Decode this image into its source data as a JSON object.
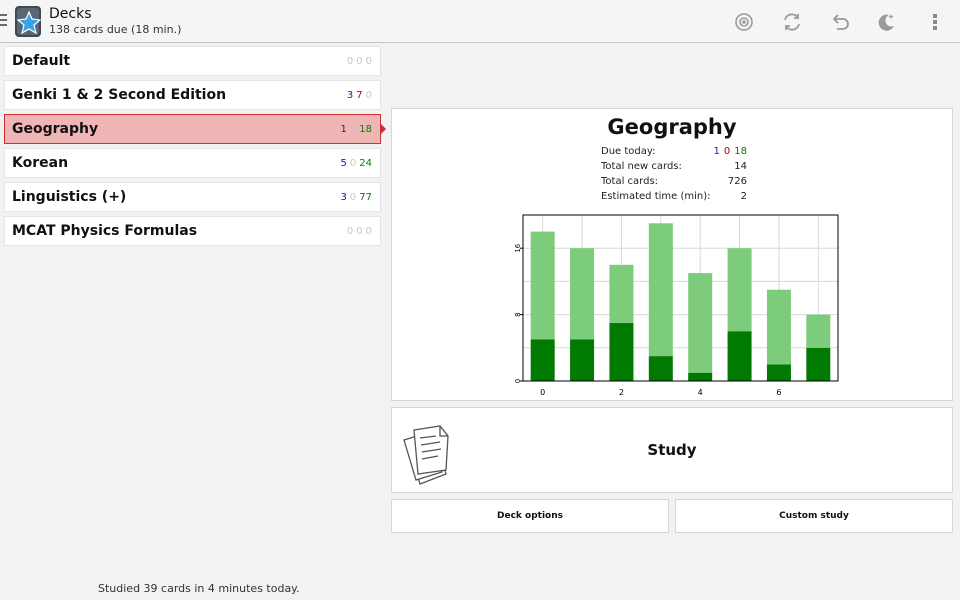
{
  "actionbar": {
    "title": "Decks",
    "subtitle": "138 cards due (18 min.)",
    "icons": [
      "drawer-indicator",
      "anki-logo",
      "target-icon",
      "sync-icon",
      "undo-icon",
      "night-mode-icon",
      "overflow-menu-icon"
    ]
  },
  "decks": [
    {
      "name": "Default",
      "new": "0",
      "learn": "0",
      "review": "0"
    },
    {
      "name": "Genki 1 & 2 Second Edition",
      "new": "3",
      "learn": "7",
      "review": "0"
    },
    {
      "name": "Geography",
      "new": "1",
      "learn": "0",
      "review": "18",
      "selected": true
    },
    {
      "name": "Korean",
      "new": "5",
      "learn": "0",
      "review": "24"
    },
    {
      "name": "Linguistics (+)",
      "new": "3",
      "learn": "0",
      "review": "77"
    },
    {
      "name": "MCAT Physics Formulas",
      "new": "0",
      "learn": "0",
      "review": "0"
    }
  ],
  "footer": "Studied 39 cards in 4 minutes today.",
  "overview": {
    "title": "Geography",
    "due_label": "Due today:",
    "due_new": "1",
    "due_learn": "0",
    "due_review": "18",
    "total_new_label": "Total new cards:",
    "total_new": "14",
    "total_label": "Total cards:",
    "total": "726",
    "est_label": "Estimated time (min):",
    "est": "2"
  },
  "chart_data": {
    "type": "bar",
    "stacked": true,
    "x": [
      0,
      1,
      2,
      3,
      4,
      5,
      6,
      7
    ],
    "series": [
      {
        "values": [
          5,
          5,
          7,
          3,
          1,
          6,
          2,
          4
        ],
        "color": "#007a00"
      },
      {
        "values": [
          13,
          11,
          7,
          16,
          12,
          10,
          9,
          4
        ],
        "color": "#7ccc7c"
      }
    ],
    "xticks": [
      "0",
      "2",
      "4",
      "6"
    ],
    "yticks": [
      "0",
      "8",
      "16"
    ],
    "ylim": [
      0,
      20
    ],
    "grid": true
  },
  "study": {
    "label": "Study"
  },
  "buttons": {
    "deck_options": "Deck options",
    "custom_study": "Custom study"
  },
  "colors": {
    "new": "#1a1aa6",
    "learn": "#b00000",
    "review": "#0a7a0a",
    "zero": "#c8c8c8",
    "selected_bg": "#f0b6b6",
    "selected_border": "#d03030"
  }
}
